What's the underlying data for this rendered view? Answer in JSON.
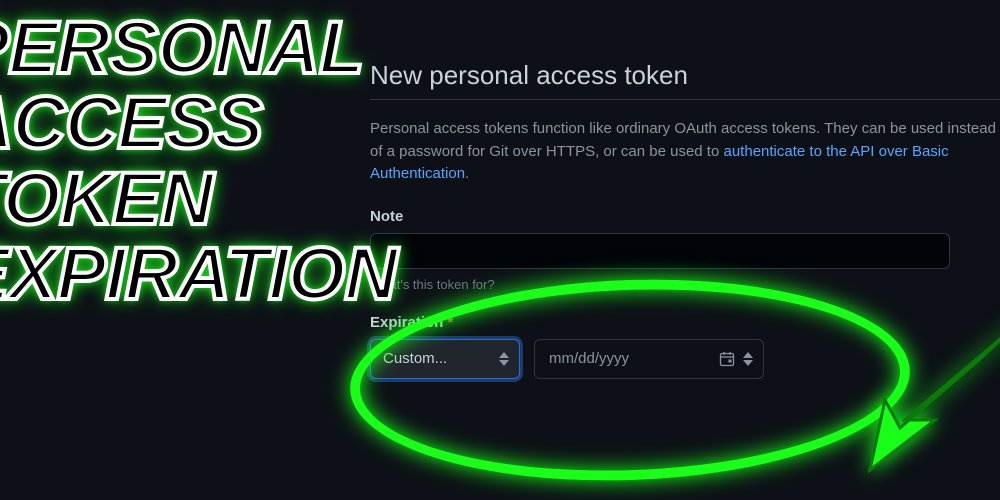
{
  "overlay": {
    "line1": "PERSONAL",
    "line2": "ACCESS",
    "line3": "TOKEN",
    "line4": "EXPIRATION"
  },
  "page": {
    "title": "New personal access token",
    "desc_pre": "Personal access tokens function like ordinary OAuth access tokens. They can be used instead of a password for Git over HTTPS, or can be used to ",
    "desc_link": "authenticate to the API over Basic Authentication",
    "desc_post": "."
  },
  "note": {
    "label": "Note",
    "value": "",
    "hint": "What's this token for?"
  },
  "expiration": {
    "label": "Expiration",
    "required_marker": "*",
    "select_value": "Custom...",
    "date_placeholder": "mm/dd/yyyy"
  }
}
